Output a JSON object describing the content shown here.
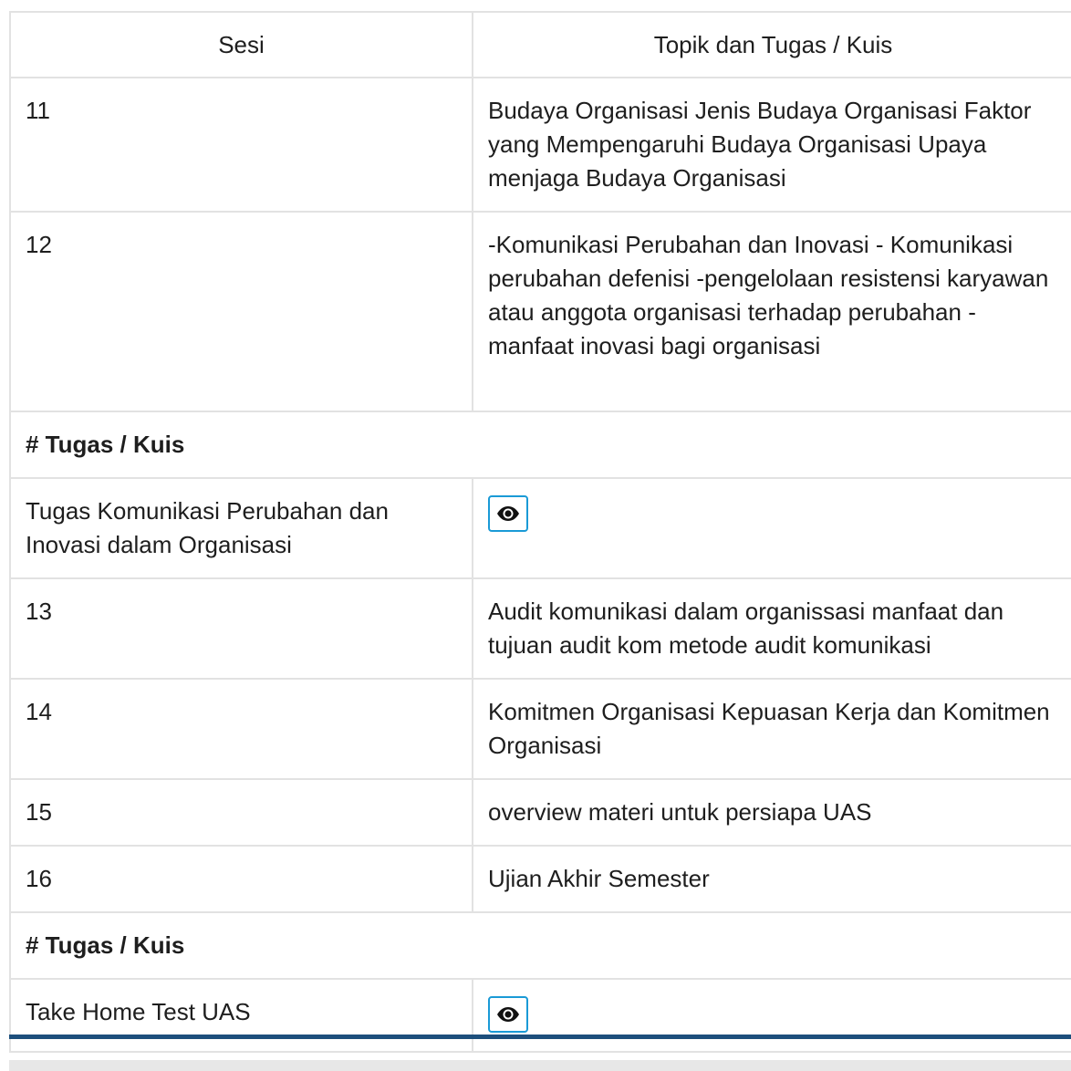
{
  "table": {
    "headers": [
      "Sesi",
      "Topik dan Tugas / Kuis"
    ],
    "rows": [
      {
        "sesi": "11",
        "topik": "Budaya Organisasi Jenis Budaya Organisasi Faktor yang Mempengaruhi Budaya Organisasi Upaya menjaga Budaya Organisasi"
      },
      {
        "sesi": "12",
        "topik": "-Komunikasi Perubahan dan Inovasi - Komunikasi perubahan defenisi -pengelolaan resistensi karyawan atau anggota organisasi terhadap perubahan -manfaat inovasi bagi organisasi"
      }
    ],
    "section_1": {
      "title": "# Tugas / Kuis",
      "task": "Tugas Komunikasi Perubahan dan Inovasi dalam Organisasi",
      "action_icon": "eye-icon"
    },
    "rows_2": [
      {
        "sesi": "13",
        "topik": "Audit komunikasi dalam organissasi manfaat dan tujuan audit kom metode audit komunikasi"
      },
      {
        "sesi": "14",
        "topik": "Komitmen Organisasi Kepuasan Kerja dan Komitmen Organisasi"
      },
      {
        "sesi": "15",
        "topik": "overview materi untuk persiapa UAS"
      },
      {
        "sesi": "16",
        "topik": "Ujian Akhir Semester"
      }
    ],
    "section_2": {
      "title": "# Tugas / Kuis",
      "task": "Take Home Test UAS",
      "action_icon": "eye-icon"
    }
  },
  "colors": {
    "border": "#e2e2e2",
    "button_border": "#1a9ad6",
    "bottom_bar": "#1d4f7c",
    "text": "#1e1e1e"
  }
}
